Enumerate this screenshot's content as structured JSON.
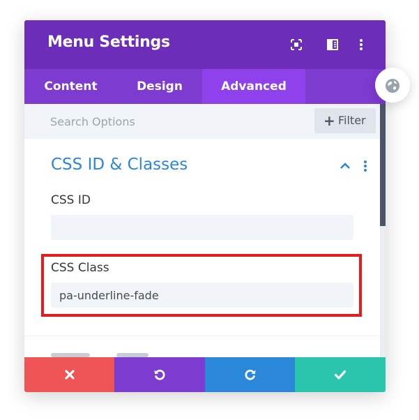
{
  "window": {
    "title": "Menu Settings",
    "header_color": "#6c2eb9",
    "tab_bar_color": "#7e3bd0",
    "active_tab_color": "#8f42ec"
  },
  "header_icons": [
    "expand-icon",
    "sidebar-toggle-icon",
    "more-options-icon"
  ],
  "tabs": [
    {
      "label": "Content",
      "active": false
    },
    {
      "label": "Design",
      "active": false
    },
    {
      "label": "Advanced",
      "active": true
    }
  ],
  "search": {
    "placeholder": "Search Options",
    "value": "",
    "filter_label": "Filter"
  },
  "section": {
    "title": "CSS ID & Classes",
    "title_color": "#2b87da",
    "expanded": true
  },
  "fields": {
    "css_id": {
      "label": "CSS ID",
      "value": ""
    },
    "css_class": {
      "label": "CSS Class",
      "value": "pa-underline-fade"
    }
  },
  "highlight_color": "#e61b1b",
  "footer": {
    "buttons": [
      {
        "action": "discard",
        "icon": "close-icon",
        "color": "#ef5555"
      },
      {
        "action": "undo",
        "icon": "undo-icon",
        "color": "#7e3bd0"
      },
      {
        "action": "redo",
        "icon": "redo-icon",
        "color": "#2b87da"
      },
      {
        "action": "save",
        "icon": "check-icon",
        "color": "#29c4a9"
      }
    ]
  },
  "side_bubble_icon": "globe-icon"
}
